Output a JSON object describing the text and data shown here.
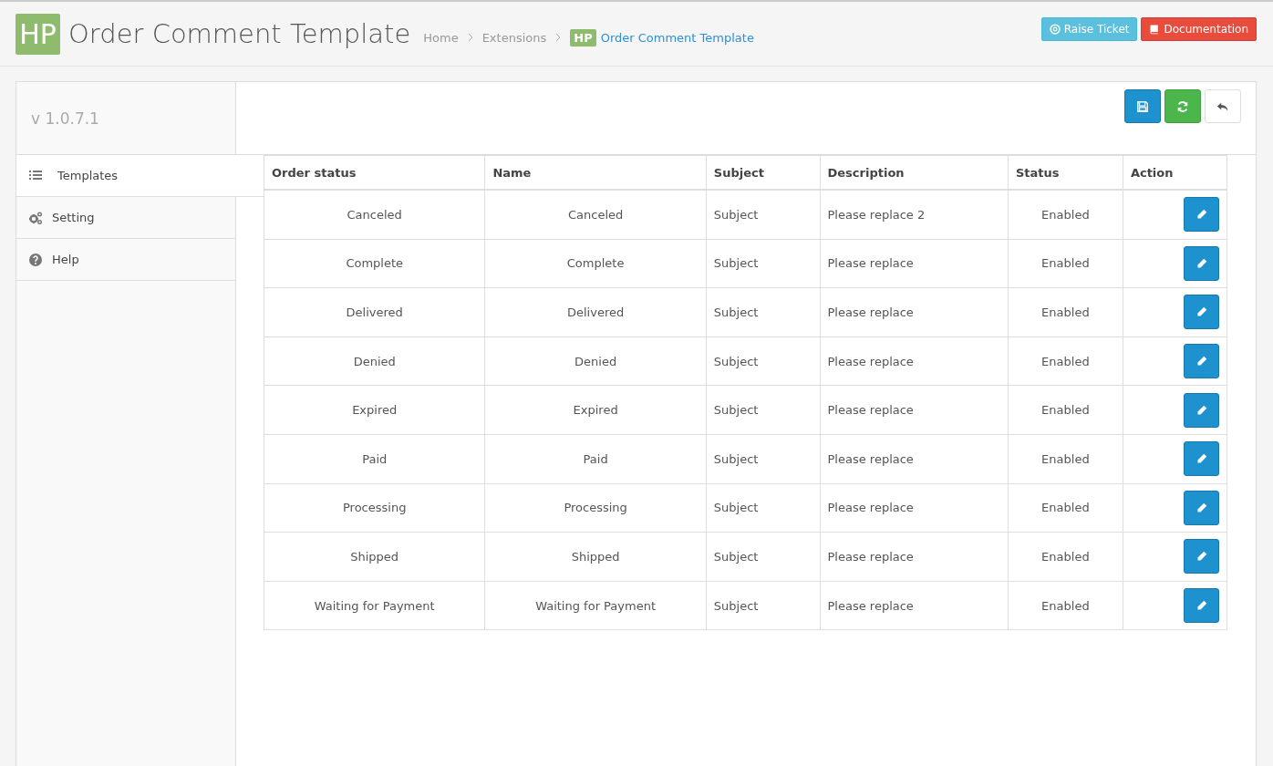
{
  "header": {
    "logo": "HP",
    "title": "Order Comment Template",
    "breadcrumb": [
      {
        "label": "Home",
        "current": false
      },
      {
        "label": "Extensions",
        "current": false
      },
      {
        "label": "Order Comment Template",
        "current": true,
        "badge": "HP"
      }
    ],
    "buttons": [
      {
        "label": "Raise Ticket",
        "kind": "info"
      },
      {
        "label": "Documentation",
        "kind": "danger"
      }
    ]
  },
  "sidebar": {
    "version": "v 1.0.7.1",
    "items": [
      {
        "label": "Templates",
        "selected": true
      },
      {
        "label": "Setting",
        "selected": false
      },
      {
        "label": "Help",
        "selected": false
      }
    ]
  },
  "toolbar": [
    {
      "kind": "save"
    },
    {
      "kind": "refresh"
    },
    {
      "kind": "back"
    }
  ],
  "table": {
    "columns": [
      "Order status",
      "Name",
      "Subject",
      "Description",
      "Status",
      "Action"
    ],
    "rows": [
      {
        "order_status": "Canceled",
        "name": "Canceled",
        "subject": "Subject",
        "description": "Please replace 2",
        "status": "Enabled"
      },
      {
        "order_status": "Complete",
        "name": "Complete",
        "subject": "Subject",
        "description": "Please replace",
        "status": "Enabled"
      },
      {
        "order_status": "Delivered",
        "name": "Delivered",
        "subject": "Subject",
        "description": "Please replace",
        "status": "Enabled"
      },
      {
        "order_status": "Denied",
        "name": "Denied",
        "subject": "Subject",
        "description": "Please replace",
        "status": "Enabled"
      },
      {
        "order_status": "Expired",
        "name": "Expired",
        "subject": "Subject",
        "description": "Please replace",
        "status": "Enabled"
      },
      {
        "order_status": "Paid",
        "name": "Paid",
        "subject": "Subject",
        "description": "Please replace",
        "status": "Enabled"
      },
      {
        "order_status": "Processing",
        "name": "Processing",
        "subject": "Subject",
        "description": "Please replace",
        "status": "Enabled"
      },
      {
        "order_status": "Shipped",
        "name": "Shipped",
        "subject": "Subject",
        "description": "Please replace",
        "status": "Enabled"
      },
      {
        "order_status": "Waiting for Payment",
        "name": "Waiting for Payment",
        "subject": "Subject",
        "description": "Please replace",
        "status": "Enabled"
      }
    ]
  }
}
